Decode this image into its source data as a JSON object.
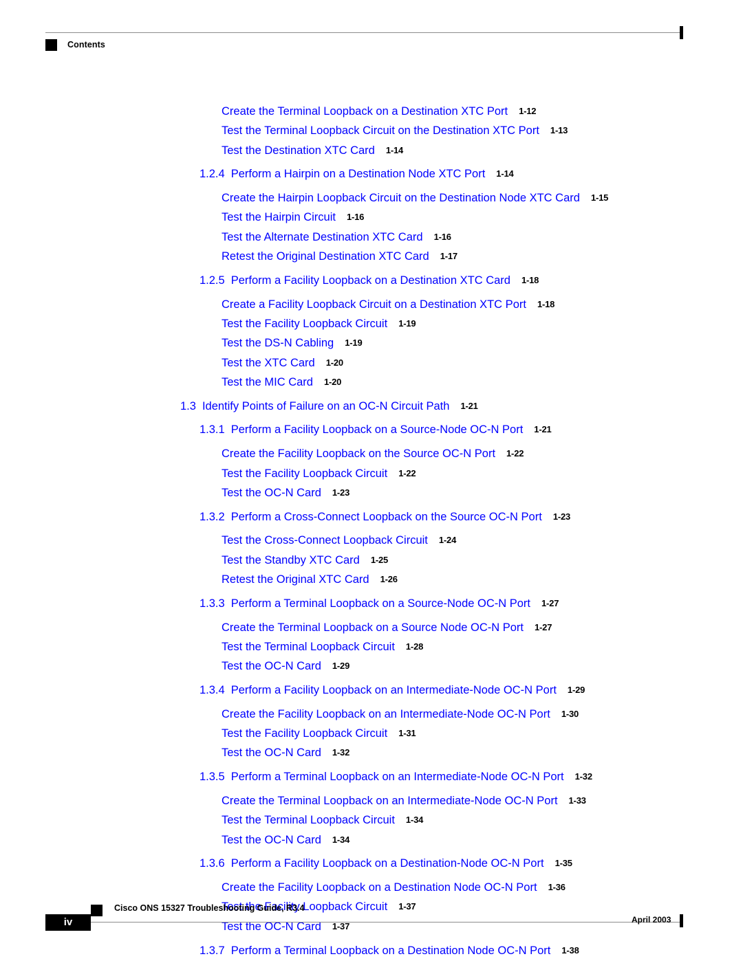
{
  "header": {
    "running_head": "Contents"
  },
  "colors": {
    "link_blue": "#0000FF",
    "page_number_black": "#000000",
    "rule_gray": "#8C8C8C"
  },
  "toc": {
    "entries": [
      {
        "level": 3,
        "number": "",
        "title": "Create the Terminal Loopback on a Destination XTC Port",
        "page": "1-12",
        "gap_before": false
      },
      {
        "level": 3,
        "number": "",
        "title": "Test the Terminal Loopback Circuit on the Destination XTC Port",
        "page": "1-13",
        "gap_before": false
      },
      {
        "level": 3,
        "number": "",
        "title": "Test the Destination XTC Card",
        "page": "1-14",
        "gap_before": false
      },
      {
        "level": 2,
        "number": "1.2.4",
        "title": "Perform a Hairpin on a Destination Node XTC Port",
        "page": "1-14",
        "gap_before": true
      },
      {
        "level": 3,
        "number": "",
        "title": "Create the Hairpin Loopback Circuit on the Destination Node XTC Card",
        "page": "1-15",
        "gap_before": true
      },
      {
        "level": 3,
        "number": "",
        "title": "Test the Hairpin Circuit",
        "page": "1-16",
        "gap_before": false
      },
      {
        "level": 3,
        "number": "",
        "title": "Test the Alternate Destination XTC Card",
        "page": "1-16",
        "gap_before": false
      },
      {
        "level": 3,
        "number": "",
        "title": "Retest the Original Destination XTC Card",
        "page": "1-17",
        "gap_before": false
      },
      {
        "level": 2,
        "number": "1.2.5",
        "title": "Perform a Facility Loopback on a Destination XTC Card",
        "page": "1-18",
        "gap_before": true
      },
      {
        "level": 3,
        "number": "",
        "title": "Create a Facility Loopback Circuit on a Destination XTC Port",
        "page": "1-18",
        "gap_before": true
      },
      {
        "level": 3,
        "number": "",
        "title": "Test the Facility Loopback Circuit",
        "page": "1-19",
        "gap_before": false
      },
      {
        "level": 3,
        "number": "",
        "title": "Test the DS-N Cabling",
        "page": "1-19",
        "gap_before": false
      },
      {
        "level": 3,
        "number": "",
        "title": "Test the XTC Card",
        "page": "1-20",
        "gap_before": false
      },
      {
        "level": 3,
        "number": "",
        "title": "Test the MIC Card",
        "page": "1-20",
        "gap_before": false
      },
      {
        "level": 1,
        "number": "1.3",
        "title": "Identify Points of Failure on an OC-N Circuit Path",
        "page": "1-21",
        "gap_before": true
      },
      {
        "level": 2,
        "number": "1.3.1",
        "title": "Perform a Facility Loopback on a Source-Node OC-N Port",
        "page": "1-21",
        "gap_before": true
      },
      {
        "level": 3,
        "number": "",
        "title": "Create the Facility Loopback on the Source OC-N Port",
        "page": "1-22",
        "gap_before": true
      },
      {
        "level": 3,
        "number": "",
        "title": "Test the Facility Loopback Circuit",
        "page": "1-22",
        "gap_before": false
      },
      {
        "level": 3,
        "number": "",
        "title": "Test the OC-N Card",
        "page": "1-23",
        "gap_before": false
      },
      {
        "level": 2,
        "number": "1.3.2",
        "title": "Perform a Cross-Connect Loopback on the Source OC-N Port",
        "page": "1-23",
        "gap_before": true
      },
      {
        "level": 3,
        "number": "",
        "title": "Test the Cross-Connect Loopback Circuit",
        "page": "1-24",
        "gap_before": true
      },
      {
        "level": 3,
        "number": "",
        "title": "Test the Standby XTC Card",
        "page": "1-25",
        "gap_before": false
      },
      {
        "level": 3,
        "number": "",
        "title": "Retest the Original XTC Card",
        "page": "1-26",
        "gap_before": false
      },
      {
        "level": 2,
        "number": "1.3.3",
        "title": "Perform a Terminal Loopback on a Source-Node OC-N Port",
        "page": "1-27",
        "gap_before": true
      },
      {
        "level": 3,
        "number": "",
        "title": "Create the Terminal Loopback on a Source Node OC-N Port",
        "page": "1-27",
        "gap_before": true
      },
      {
        "level": 3,
        "number": "",
        "title": "Test the Terminal Loopback Circuit",
        "page": "1-28",
        "gap_before": false
      },
      {
        "level": 3,
        "number": "",
        "title": "Test the OC-N Card",
        "page": "1-29",
        "gap_before": false
      },
      {
        "level": 2,
        "number": "1.3.4",
        "title": "Perform a Facility Loopback on an Intermediate-Node OC-N Port",
        "page": "1-29",
        "gap_before": true
      },
      {
        "level": 3,
        "number": "",
        "title": "Create the Facility Loopback on an Intermediate-Node OC-N Port",
        "page": "1-30",
        "gap_before": true
      },
      {
        "level": 3,
        "number": "",
        "title": "Test the Facility Loopback Circuit",
        "page": "1-31",
        "gap_before": false
      },
      {
        "level": 3,
        "number": "",
        "title": "Test the OC-N Card",
        "page": "1-32",
        "gap_before": false
      },
      {
        "level": 2,
        "number": "1.3.5",
        "title": "Perform a Terminal Loopback on an Intermediate-Node OC-N Port",
        "page": "1-32",
        "gap_before": true
      },
      {
        "level": 3,
        "number": "",
        "title": "Create the Terminal Loopback on an Intermediate-Node OC-N Port",
        "page": "1-33",
        "gap_before": true
      },
      {
        "level": 3,
        "number": "",
        "title": "Test the Terminal Loopback Circuit",
        "page": "1-34",
        "gap_before": false
      },
      {
        "level": 3,
        "number": "",
        "title": "Test the OC-N Card",
        "page": "1-34",
        "gap_before": false
      },
      {
        "level": 2,
        "number": "1.3.6",
        "title": "Perform a Facility Loopback on a Destination-Node OC-N Port",
        "page": "1-35",
        "gap_before": true
      },
      {
        "level": 3,
        "number": "",
        "title": "Create the Facility Loopback on a Destination Node OC-N Port",
        "page": "1-36",
        "gap_before": true
      },
      {
        "level": 3,
        "number": "",
        "title": "Test the Facility Loopback Circuit",
        "page": "1-37",
        "gap_before": false
      },
      {
        "level": 3,
        "number": "",
        "title": "Test the OC-N Card",
        "page": "1-37",
        "gap_before": false
      },
      {
        "level": 2,
        "number": "1.3.7",
        "title": "Perform a Terminal Loopback on a Destination Node OC-N Port",
        "page": "1-38",
        "gap_before": true
      }
    ]
  },
  "footer": {
    "page_number": "iv",
    "document_title": "Cisco ONS 15327 Troubleshooting Guide, R3.4",
    "date": "April 2003"
  }
}
